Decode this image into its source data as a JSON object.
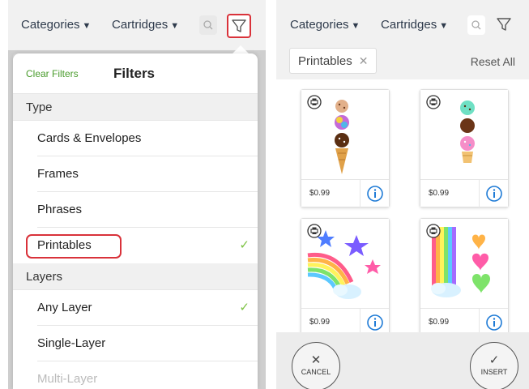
{
  "left": {
    "nav": {
      "categories": "Categories",
      "cartridges": "Cartridges"
    },
    "filters": {
      "clear_label": "Clear Filters",
      "title": "Filters",
      "sections": [
        {
          "header": "Type",
          "options": [
            {
              "label": "Cards & Envelopes",
              "checked": false
            },
            {
              "label": "Frames",
              "checked": false
            },
            {
              "label": "Phrases",
              "checked": false
            },
            {
              "label": "Printables",
              "checked": true
            }
          ]
        },
        {
          "header": "Layers",
          "options": [
            {
              "label": "Any Layer",
              "checked": true
            },
            {
              "label": "Single-Layer",
              "checked": false
            },
            {
              "label": "Multi-Layer",
              "checked": false
            }
          ]
        }
      ],
      "check_glyph": "✓"
    }
  },
  "right": {
    "nav": {
      "categories": "Categories",
      "cartridges": "Cartridges"
    },
    "active_filter_chip": "Printables",
    "reset_all": "Reset All",
    "results": [
      {
        "price": "$0.99",
        "art": "ice-cream-cone-a"
      },
      {
        "price": "$0.99",
        "art": "ice-cream-cone-b"
      },
      {
        "price": "$0.99",
        "art": "rainbow-stars"
      },
      {
        "price": "$0.99",
        "art": "rainbow-hearts"
      }
    ],
    "cancel_label": "CANCEL",
    "insert_label": "INSERT"
  },
  "colors": {
    "accent_green": "#7cc242",
    "highlight_red": "#d9323a",
    "info_blue": "#1f7bd6"
  }
}
